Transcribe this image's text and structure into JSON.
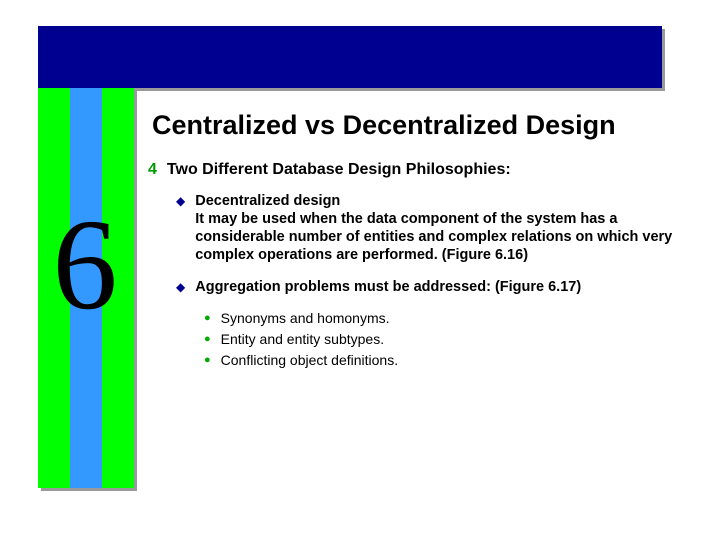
{
  "chapter_number": "6",
  "title": "Centralized vs Decentralized Design",
  "heading": "Two Different Database Design Philosophies:",
  "point1": {
    "head": "Decentralized design",
    "body": "It may be used when the data component of the system has a considerable number of entities and complex relations on which very complex operations are performed. (Figure 6.16)"
  },
  "point2": {
    "head": "Aggregation problems must be addressed: (Figure 6.17)",
    "subs": {
      "a": "Synonyms and homonyms.",
      "b": "Entity and entity subtypes.",
      "c": "Conflicting object definitions."
    }
  }
}
